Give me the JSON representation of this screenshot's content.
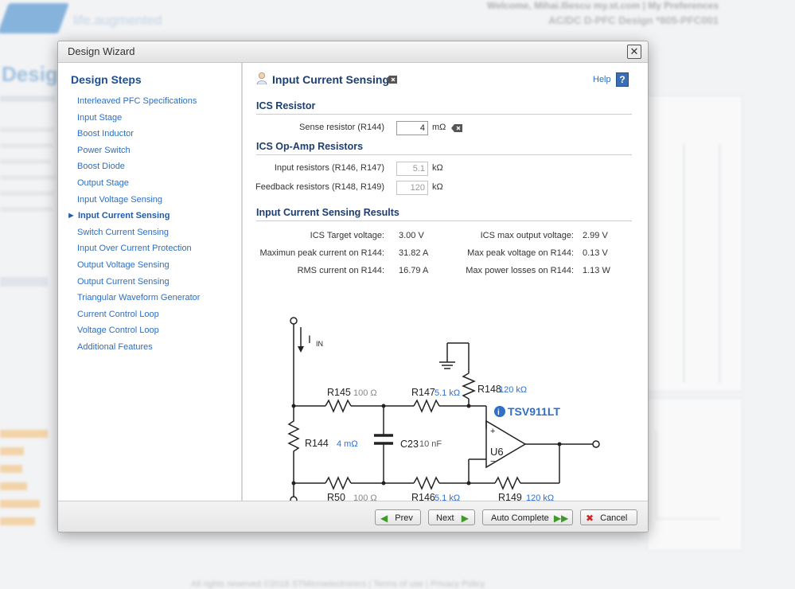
{
  "background": {
    "tagline": "life.augmented",
    "welcome": "Welcome, Mihai.Iliescu  my.st.com | My Preferences",
    "design_id": "AC/DC D-PFC Design  *805-PFC001",
    "big_title": "Desig",
    "footer": "All rights reserved ©2018 STMicroelectronics | Terms of use | Privacy Policy"
  },
  "wizard": {
    "title": "Design Wizard",
    "steps_heading": "Design Steps",
    "steps": [
      "Interleaved PFC Specifications",
      "Input Stage",
      "Boost Inductor",
      "Power Switch",
      "Boost Diode",
      "Output Stage",
      "Input Voltage Sensing",
      "► Input Current Sensing",
      "Switch Current Sensing",
      "Input Over Current Protection",
      "Output Voltage Sensing",
      "Output Current Sensing",
      "Triangular Waveform Generator",
      "Current Control Loop",
      "Voltage Control Loop",
      "Additional Features"
    ],
    "active_step_index": 7,
    "page_title": "Input Current Sensing",
    "help_label": "Help",
    "ics_resistor": {
      "heading": "ICS Resistor",
      "sense_label": "Sense resistor (R144)",
      "sense_value": "4",
      "sense_unit": "mΩ"
    },
    "opamp": {
      "heading": "ICS Op-Amp Resistors",
      "input_label": "Input resistors (R146, R147)",
      "input_value": "5.1",
      "input_unit": "kΩ",
      "feedback_label": "Feedback resistors (R148, R149)",
      "feedback_value": "120",
      "feedback_unit": "kΩ"
    },
    "results": {
      "heading": "Input Current Sensing Results",
      "left": [
        {
          "label": "ICS Target voltage:",
          "value": "3.00 V"
        },
        {
          "label": "Maximun peak current on R144:",
          "value": "31.82 A"
        },
        {
          "label": "RMS current on R144:",
          "value": "16.79 A"
        }
      ],
      "right": [
        {
          "label": "ICS max output voltage:",
          "value": "2.99 V"
        },
        {
          "label": "Max peak voltage on R144:",
          "value": "0.13 V"
        },
        {
          "label": "Max power losses on R144:",
          "value": "1.13 W"
        }
      ]
    },
    "schematic": {
      "iin": "I",
      "iin_sub": "IN",
      "r145": "R145",
      "r145_val": "100 Ω",
      "r147": "R147",
      "r147_val": "5.1 kΩ",
      "r148": "R148",
      "r148_val": "120 kΩ",
      "r144": "R144",
      "r144_val": "4 mΩ",
      "c23": "C23",
      "c23_val": "10 nF",
      "r50": "R50",
      "r50_val": "100 Ω",
      "r146": "R146",
      "r146_val": "5.1 kΩ",
      "r149": "R149",
      "r149_val": "120 kΩ",
      "u6": "U6",
      "opamp_name": "TSV911LT",
      "plus": "+",
      "minus": "−"
    },
    "buttons": {
      "prev": "Prev",
      "next": "Next",
      "auto": "Auto Complete",
      "cancel": "Cancel"
    }
  },
  "colors": {
    "heading_blue": "#1f4e8c",
    "link_blue": "#2d6fc2",
    "value_blue": "#2f6fc8"
  }
}
